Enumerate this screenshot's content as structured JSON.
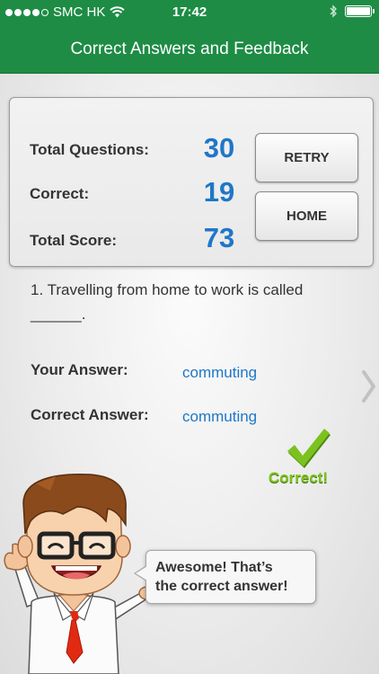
{
  "status_bar": {
    "carrier": "SMC HK",
    "time": "17:42",
    "wifi_icon": "wifi-icon",
    "bluetooth_icon": "bluetooth-icon",
    "battery_icon": "battery-icon",
    "battery_level": 1.0,
    "signal_bars_filled": 4,
    "signal_bars_total": 5
  },
  "nav": {
    "title": "Correct Answers and Feedback"
  },
  "score": {
    "total_questions_label": "Total Questions:",
    "total_questions_value": "30",
    "correct_label": "Correct:",
    "correct_value": "19",
    "total_score_label": "Total Score:",
    "total_score_value": "73"
  },
  "buttons": {
    "retry": "RETRY",
    "home": "HOME"
  },
  "question": {
    "text": "1. Travelling from home to work is called ______."
  },
  "answers": {
    "your_answer_label": "Your Answer:",
    "your_answer_value": "commuting",
    "correct_answer_label": "Correct Answer:",
    "correct_answer_value": "commuting"
  },
  "feedback": {
    "result": "Correct!",
    "check_icon": "checkmark-icon",
    "next_icon": "chevron-right-icon",
    "bubble_line1": "Awesome!  That’s",
    "bubble_line2": "the correct answer!"
  },
  "colors": {
    "brand_green": "#1e8c45",
    "value_blue": "#1f77c8",
    "correct_green": "#7cc21f"
  }
}
